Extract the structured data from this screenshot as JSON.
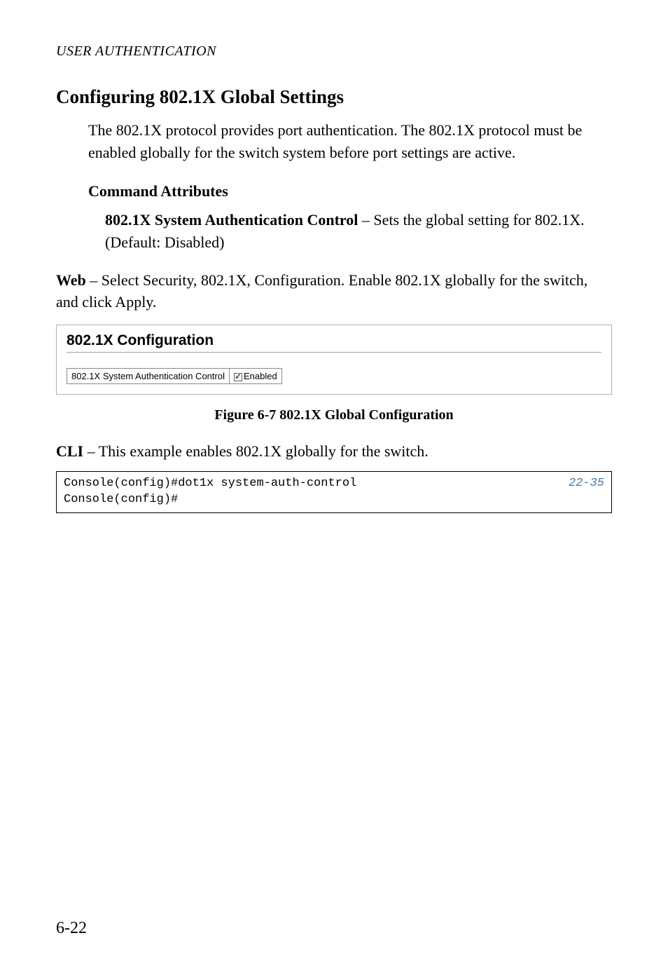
{
  "running_header": "USER AUTHENTICATION",
  "section_heading": "Configuring 802.1X Global Settings",
  "intro_para": "The 802.1X protocol provides port authentication. The 802.1X protocol must be enabled globally for the switch system before port settings are active.",
  "command_attributes_heading": "Command Attributes",
  "attr_label": "802.1X System Authentication Control",
  "attr_desc": " – Sets the global setting for 802.1X. (Default: Disabled)",
  "web_label": "Web",
  "web_desc": " – Select Security, 802.1X, Configuration. Enable 802.1X globally for the switch, and click Apply.",
  "screenshot": {
    "title": "802.1X Configuration",
    "row_label": "802.1X System Authentication Control",
    "checkbox_label": "Enabled"
  },
  "figure_caption": "Figure 6-7  802.1X Global Configuration",
  "cli_label": "CLI",
  "cli_desc": " – This example enables 802.1X globally for the switch.",
  "code": {
    "line1": "Console(config)#dot1x system-auth-control",
    "ref": "22-35",
    "line2": "Console(config)#"
  },
  "page_number": "6-22"
}
